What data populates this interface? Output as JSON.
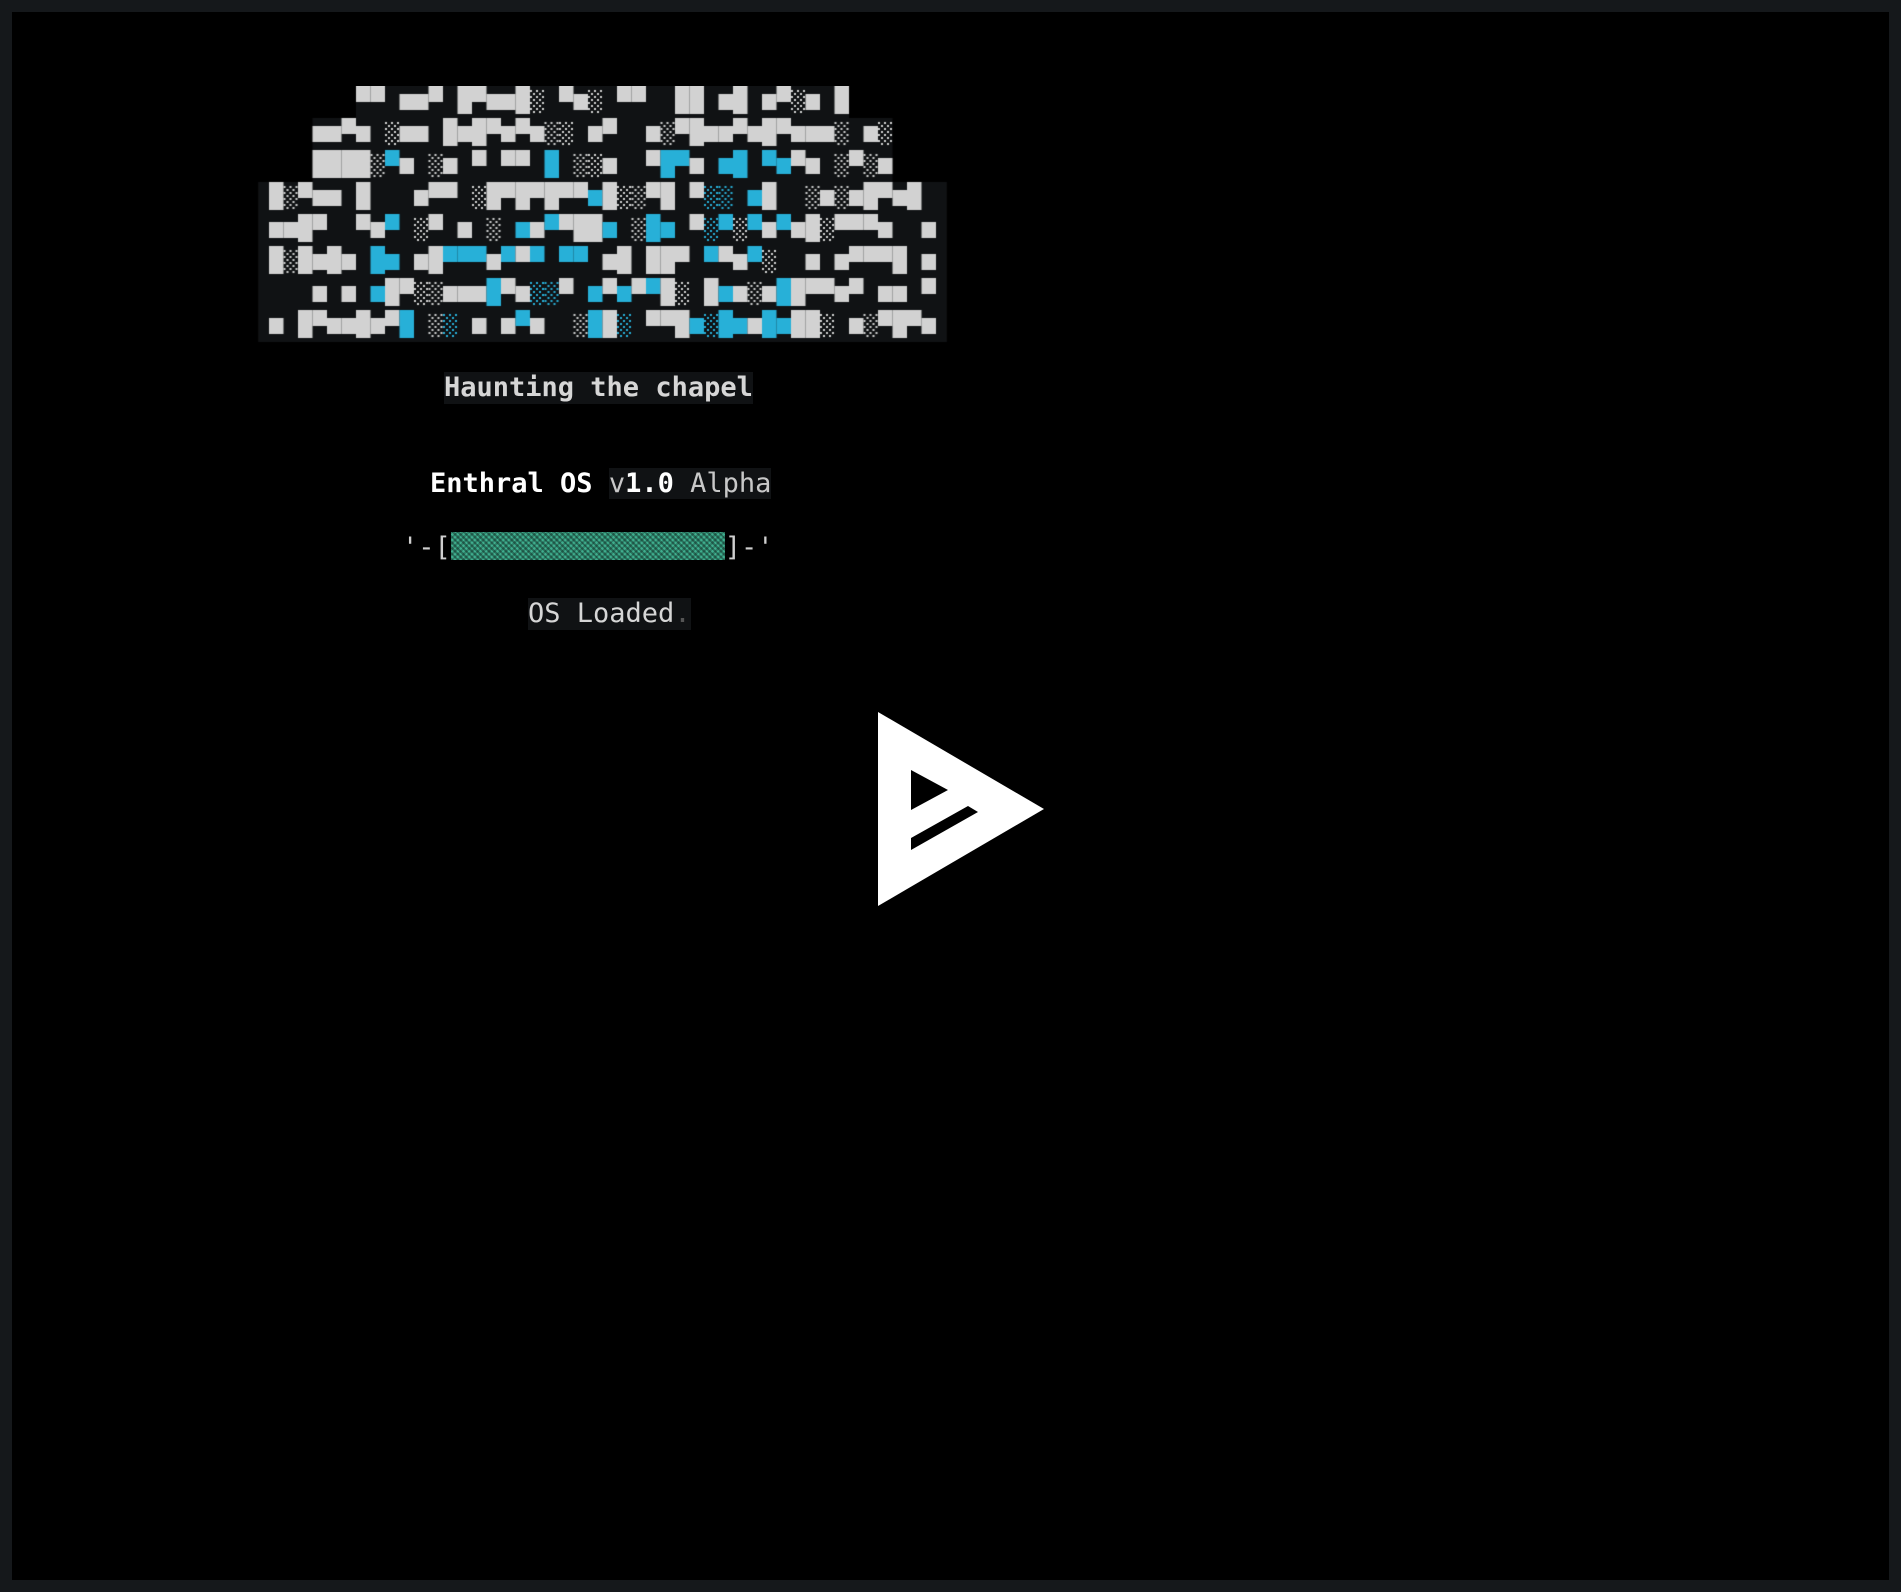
{
  "logo": {
    "icon": "ascii-art-logo-icon",
    "accent_color": "#27b0d8",
    "fg_color": "#d2d2d2"
  },
  "tagline": "Haunting the chapel",
  "title": {
    "os_name": "Enthral OS",
    "version_prefix": "v",
    "version_number": "1.0",
    "release": "Alpha"
  },
  "progress": {
    "left_cap": "'-[",
    "right_cap": "]-'",
    "value": 1.0,
    "color": "#3fae8e"
  },
  "status": {
    "text": "OS Loaded",
    "suffix": "."
  },
  "center_icon": {
    "icon": "asciinema-play-icon",
    "color": "#ffffff"
  }
}
